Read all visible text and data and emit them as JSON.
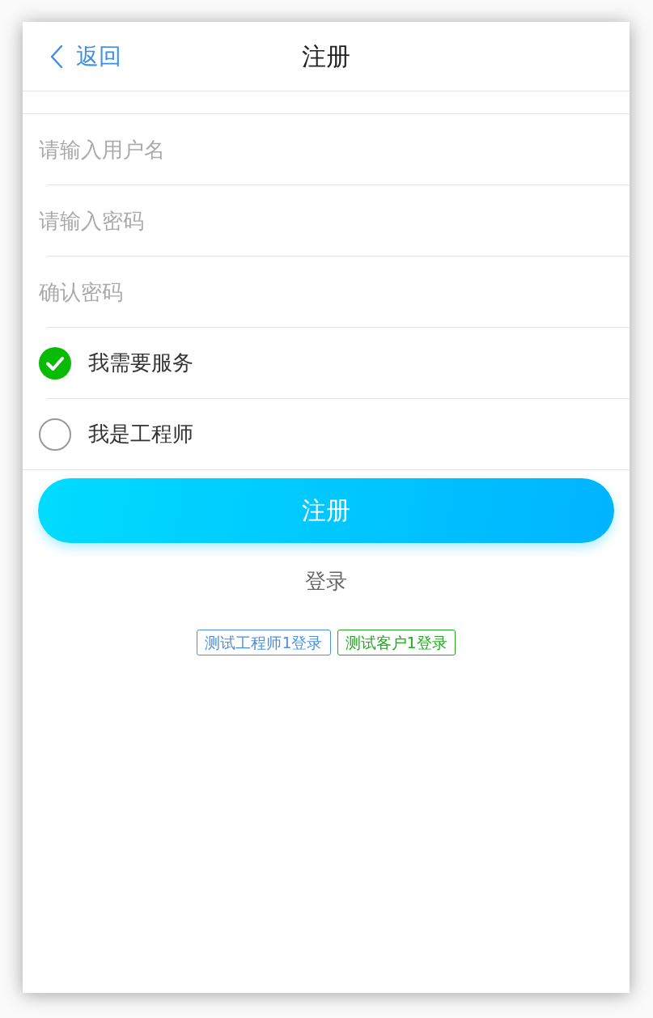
{
  "header": {
    "back_label": "返回",
    "title": "注册"
  },
  "fields": [
    {
      "placeholder": "请输入用户名"
    },
    {
      "placeholder": "请输入密码"
    },
    {
      "placeholder": "确认密码"
    }
  ],
  "roles": [
    {
      "label": "我需要服务",
      "selected": true
    },
    {
      "label": "我是工程师",
      "selected": false
    }
  ],
  "register_button": "注册",
  "login_link": "登录",
  "test_logins": [
    {
      "label": "测试工程师1登录",
      "color": "#4a90e2"
    },
    {
      "label": "测试客户1登录",
      "color": "#1aad19"
    }
  ]
}
